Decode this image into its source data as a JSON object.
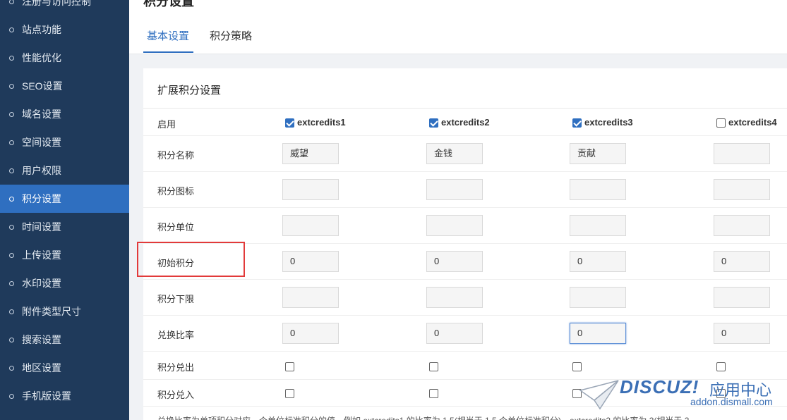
{
  "sidebar": {
    "items": [
      {
        "label": "注册与访问控制",
        "active": false
      },
      {
        "label": "站点功能",
        "active": false
      },
      {
        "label": "性能优化",
        "active": false
      },
      {
        "label": "SEO设置",
        "active": false
      },
      {
        "label": "域名设置",
        "active": false
      },
      {
        "label": "空间设置",
        "active": false
      },
      {
        "label": "用户权限",
        "active": false
      },
      {
        "label": "积分设置",
        "active": true
      },
      {
        "label": "时间设置",
        "active": false
      },
      {
        "label": "上传设置",
        "active": false
      },
      {
        "label": "水印设置",
        "active": false
      },
      {
        "label": "附件类型尺寸",
        "active": false
      },
      {
        "label": "搜索设置",
        "active": false
      },
      {
        "label": "地区设置",
        "active": false
      },
      {
        "label": "手机版设置",
        "active": false
      }
    ]
  },
  "header": {
    "title": "积分设置",
    "tabs": [
      {
        "label": "基本设置",
        "active": true
      },
      {
        "label": "积分策略",
        "active": false
      }
    ]
  },
  "card": {
    "title": "扩展积分设置",
    "enable_label": "启用",
    "columns": [
      {
        "name": "extcredits1",
        "enabled": true
      },
      {
        "name": "extcredits2",
        "enabled": true
      },
      {
        "name": "extcredits3",
        "enabled": true
      },
      {
        "name": "extcredits4",
        "enabled": false
      }
    ],
    "rows": [
      {
        "label": "积分名称",
        "type": "input",
        "values": [
          "威望",
          "金钱",
          "贡献",
          ""
        ]
      },
      {
        "label": "积分图标",
        "type": "input",
        "values": [
          "",
          "",
          "",
          ""
        ]
      },
      {
        "label": "积分单位",
        "type": "input",
        "values": [
          "",
          "",
          "",
          ""
        ]
      },
      {
        "label": "初始积分",
        "type": "input",
        "values": [
          "0",
          "0",
          "0",
          "0"
        ]
      },
      {
        "label": "积分下限",
        "type": "input",
        "values": [
          "",
          "",
          "",
          ""
        ]
      },
      {
        "label": "兑换比率",
        "type": "input",
        "values": [
          "0",
          "0",
          "0",
          "0"
        ]
      },
      {
        "label": "积分兑出",
        "type": "checkbox",
        "values": [
          false,
          false,
          false,
          false
        ]
      },
      {
        "label": "积分兑入",
        "type": "checkbox",
        "values": [
          false,
          false,
          false,
          false
        ]
      }
    ],
    "footer_text": "兑换比率为单项积分对应一个单位标准积分的值，例如 extcredits1 的比率为 1.5(相当于 1.5 个单位标准积分)，extcredits2 的比率为 3(相当于 3"
  },
  "watermark": {
    "brand": "DISCUZ!",
    "center": "应用中心",
    "url": "addon.dismall.com"
  },
  "colors": {
    "sidebar_bg": "#1f3a5b",
    "accent": "#2f6fc0",
    "highlight_box": "#e23a3a"
  }
}
